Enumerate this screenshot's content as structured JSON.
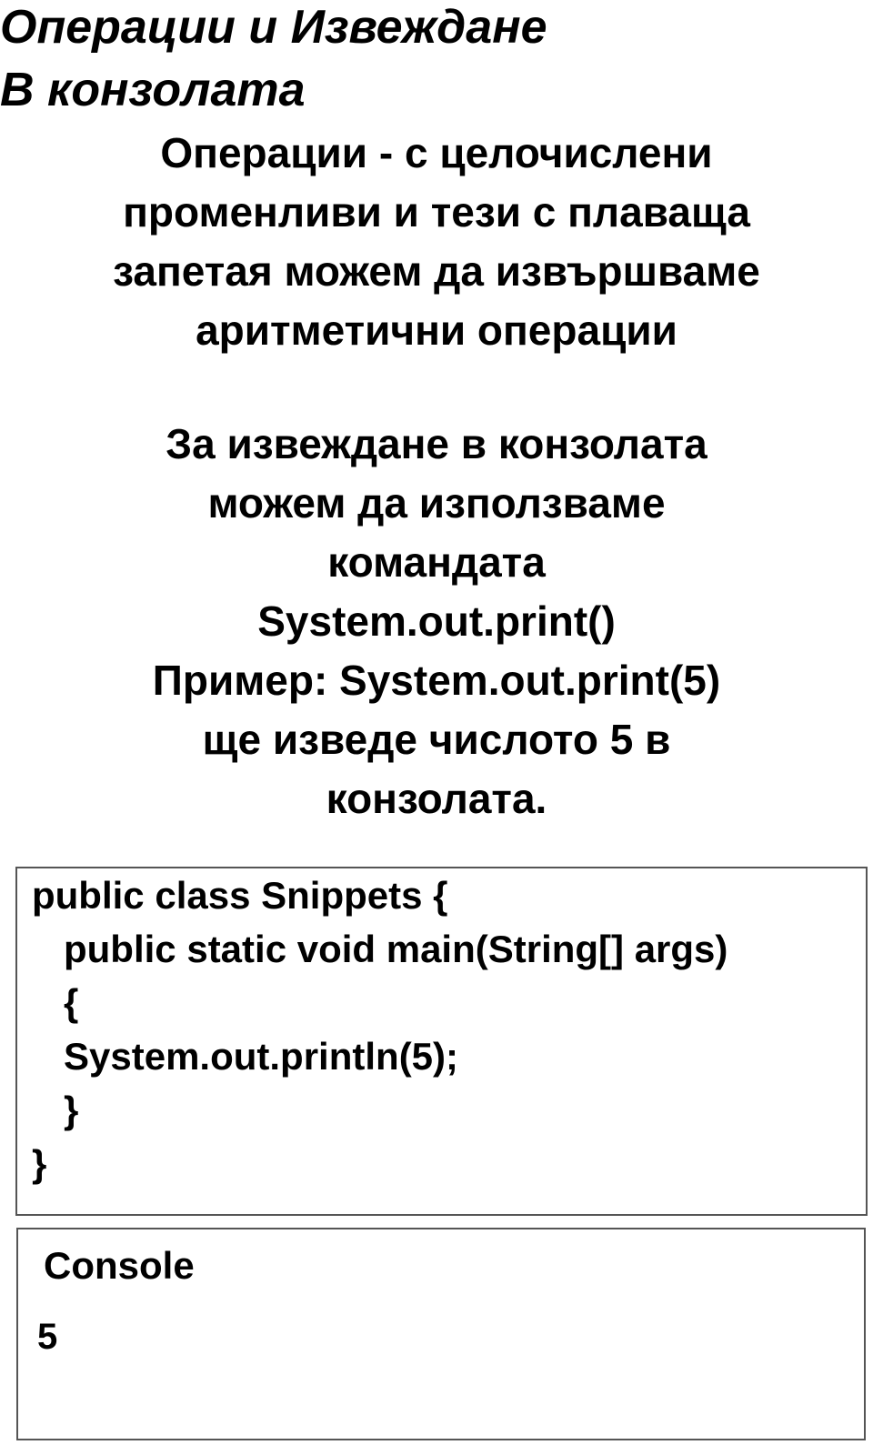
{
  "title": {
    "line1": "Операции и Извеждане",
    "line2": "В конзолата"
  },
  "paragraph1": {
    "lines": [
      "Операции - с целочислени",
      "променливи и тези с плаваща",
      "запетая можем да извършваме",
      "аритметични операции"
    ]
  },
  "paragraph2": {
    "lines": [
      "За извеждане в конзолата",
      "можем да използваме",
      "командата",
      "System.out.print()",
      "Пример: System.out.print(5)",
      "ще изведе числото 5 в",
      "конзолата."
    ]
  },
  "code": {
    "lines": [
      "public class Snippets {",
      "public static void main(String[] args)",
      "{",
      "System.out.println(5);",
      "}",
      "}"
    ]
  },
  "console": {
    "label": "Console",
    "output": "5"
  }
}
